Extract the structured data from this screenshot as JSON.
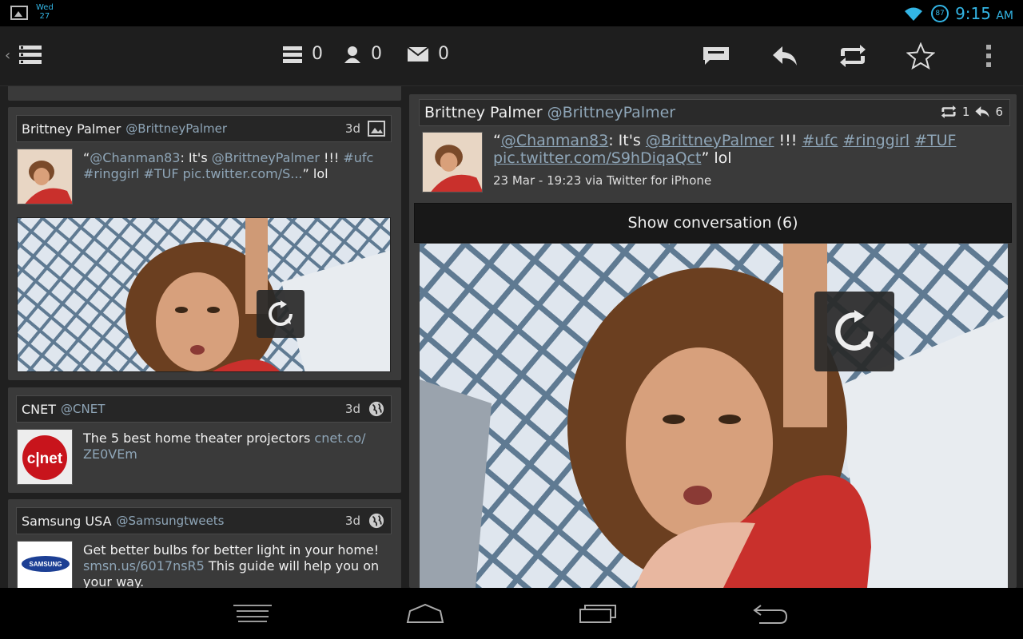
{
  "status_bar": {
    "day": "Wed",
    "date": "27",
    "battery": "87",
    "time": "9:15",
    "ampm": "AM"
  },
  "action_bar": {
    "counters": [
      {
        "icon": "timeline-icon",
        "value": "0"
      },
      {
        "icon": "mentions-icon",
        "value": "0"
      },
      {
        "icon": "messages-icon",
        "value": "0"
      }
    ],
    "actions": [
      "compose-icon",
      "reply-icon",
      "retweet-icon",
      "favorite-icon",
      "overflow-menu-icon"
    ]
  },
  "timeline": [
    {
      "name": "Brittney Palmer",
      "handle": "@BrittneyPalmer",
      "age": "3d",
      "source_icon": "image-icon",
      "text_parts": [
        "“",
        "@Chanman83",
        ": It's ",
        "@BrittneyPalmer",
        " !!! ",
        "#ufc",
        " ",
        "#ringgirl",
        " ",
        "#TUF",
        " ",
        "pic.twitter.com/S...",
        "” lol"
      ]
    },
    {
      "name": "CNET",
      "handle": "@CNET",
      "age": "3d",
      "source_icon": "globe-icon",
      "avatar_text": "c|net",
      "text": "The 5 best home theater projectors ",
      "link": "cnet.co/ ZE0VEm"
    },
    {
      "name": "Samsung USA",
      "handle": "@Samsungtweets",
      "age": "3d",
      "source_icon": "globe-icon",
      "avatar_text": "SAMSUNG",
      "text": "Get better bulbs for better light in your home! ",
      "link": "smsn.us/6017nsR5",
      "text_after": " This guide will help you on your way."
    }
  ],
  "detail": {
    "name": "Brittney Palmer",
    "handle": "@BrittneyPalmer",
    "retweets": "1",
    "replies": "6",
    "text_parts": [
      "“",
      "@Chanman83",
      ": It's ",
      "@BrittneyPalmer",
      " !!! ",
      "#ufc",
      " ",
      "#ringgirl",
      " ",
      "#TUF",
      " ",
      "pic.twitter.com/S9hDiqaQct",
      "” lol"
    ],
    "meta": "23 Mar - 19:23 via Twitter for iPhone",
    "show_conversation": "Show conversation (6)"
  },
  "colors": {
    "accent": "#33b5e5",
    "link": "#8fa6b8",
    "card_bg": "#3a3a3a",
    "header_bg": "#262626"
  }
}
